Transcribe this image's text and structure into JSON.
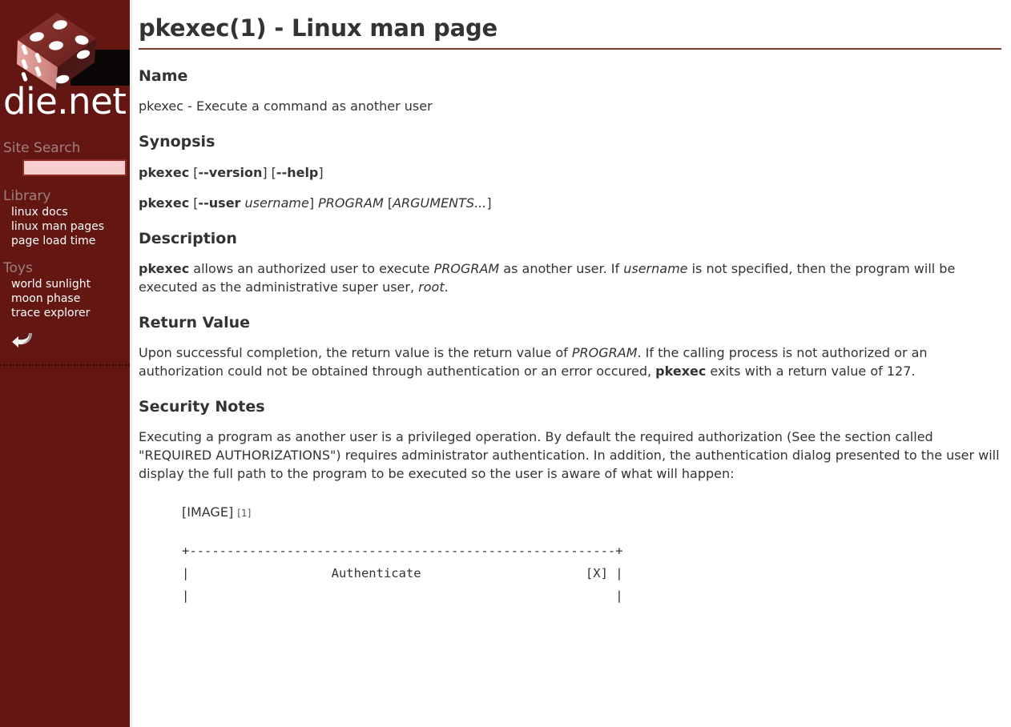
{
  "sidebar": {
    "logo_text": "die.net",
    "logo_icon": "dice-icon",
    "site_search_label": "Site Search",
    "search_placeholder": "",
    "search_value": "",
    "library_label": "Library",
    "library_links": [
      {
        "label": "linux docs"
      },
      {
        "label": "linux man pages"
      },
      {
        "label": "page load time"
      }
    ],
    "toys_label": "Toys",
    "toys_links": [
      {
        "label": "world sunlight"
      },
      {
        "label": "moon phase"
      },
      {
        "label": "trace explorer"
      }
    ],
    "back_icon": "back-arrow-icon"
  },
  "page": {
    "title": "pkexec(1) - Linux man page",
    "sections": {
      "name": {
        "heading": "Name",
        "text": "pkexec - Execute a command as another user"
      },
      "synopsis": {
        "heading": "Synopsis",
        "line1": {
          "cmd": "pkexec",
          "open1": " [",
          "opt1": "--version",
          "close1": "] [",
          "opt2": "--help",
          "close2": "]"
        },
        "line2": {
          "cmd": "pkexec",
          "open1": " [",
          "opt1": "--user",
          "arg1": "username",
          "close1": "] ",
          "arg2": "PROGRAM",
          "open2": " [",
          "arg3": "ARGUMENTS...",
          "close2": "]"
        }
      },
      "description": {
        "heading": "Description",
        "t1": "pkexec",
        "t2": " allows an authorized user to execute ",
        "t3": "PROGRAM",
        "t4": " as another user. If ",
        "t5": "username",
        "t6": " is not specified, then the program will be executed as the administrative super user, ",
        "t7": "root",
        "t8": "."
      },
      "return_value": {
        "heading": "Return Value",
        "t1": "Upon successful completion, the return value is the return value of ",
        "t2": "PROGRAM",
        "t3": ". If the calling process is not authorized or an authorization could not be obtained through authentication or an error occured, ",
        "t4": "pkexec",
        "t5": " exits with a return value of 127."
      },
      "security_notes": {
        "heading": "Security Notes",
        "text": "Executing a program as another user is a privileged operation. By default the required authorization (See the section called \"REQUIRED AUTHORIZATIONS\") requires administrator authentication. In addition, the authentication dialog presented to the user will display the full path to the program to be executed so the user is aware of what will happen:",
        "image_placeholder": "[IMAGE]",
        "footnote_ref": "[1]",
        "ascii_box": "+---------------------------------------------------------+\n|                   Authenticate                      [X] |\n|                                                         |"
      }
    }
  },
  "colors": {
    "sidebar_bg": "#631612",
    "sidebar_heading": "#9c817f",
    "sidebar_link": "#ffffff",
    "search_bg": "#f7cfcf",
    "search_border": "#8e2a24",
    "title_rule": "#7d3a33",
    "body_text": "#333333",
    "page_bg": "#ffffff"
  }
}
